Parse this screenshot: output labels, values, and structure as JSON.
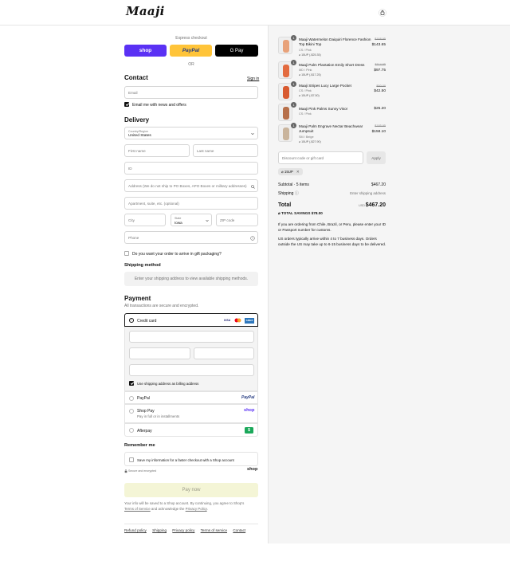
{
  "header": {
    "brand": "Maaji",
    "bag_icon": "shopping-bag-icon"
  },
  "express": {
    "title": "Express checkout",
    "shop_label": "shop",
    "paypal_label": "PayPal",
    "gpay_label": "G Pay",
    "or_label": "OR",
    "colors": {
      "shop": "#5a31f4",
      "paypal": "#ffc439",
      "gpay": "#000000"
    }
  },
  "contact": {
    "title": "Contact",
    "sign_in": "Sign in",
    "email_placeholder": "Email",
    "news_label": "Email me with news and offers"
  },
  "delivery": {
    "title": "Delivery",
    "country_label": "Country/Region",
    "country_value": "United States",
    "first_name": "First name",
    "last_name": "Last name",
    "id_field": "ID",
    "address": "Address (We do not ship to PO Boxes, APO Boxes or military addresses)",
    "apartment": "Apartment, suite, etc. (optional)",
    "city": "City",
    "state_label": "State",
    "state_value": "Iowa",
    "zip": "ZIP code",
    "phone": "Phone",
    "gift_label": "Do you want your order to arrive in gift packaging?"
  },
  "shipping": {
    "title": "Shipping method",
    "notice": "Enter your shipping address to view available shipping methods."
  },
  "payment": {
    "title": "Payment",
    "subtitle": "All transactions are secure and encrypted.",
    "credit_card": "Credit card",
    "card_brands": [
      "VISA",
      "MC",
      "AMEX"
    ],
    "billing_label": "Use shipping address as billing address",
    "paypal": "PayPal",
    "paypal_logo": "PayPal",
    "shop_pay": "Shop Pay",
    "shop_pay_sub": "Pay in full or in installments",
    "shop_logo": "shop",
    "afterpay": "Afterpay",
    "afterpay_logo": "$"
  },
  "remember": {
    "title": "Remember me",
    "save_label": "Save my information for a faster checkout with a Shop account",
    "secure": "Secure and encrypted",
    "shop_logo": "shop"
  },
  "pay_now": "Pay now",
  "legal": {
    "line1": "Your info will be saved to a Shop account. By continuing, you agree to Shop’s",
    "terms": "Terms of Service",
    "mid": " and acknowledge the ",
    "privacy": "Privacy Policy",
    "end": "."
  },
  "footer": [
    "Refund policy",
    "Shipping",
    "Privacy policy",
    "Terms of service",
    "Contact"
  ],
  "cart": {
    "items": [
      {
        "qty": "1",
        "name": "Maaji Watermelon Daiquiri Florence Fashion Top Bikini Top",
        "variant": "CS / Pink",
        "discount": "15UP (-$25.35)",
        "old_price": "$168.95",
        "price": "$143.65",
        "thumb_color": "#e8a27a"
      },
      {
        "qty": "1",
        "name": "Maaji Palm Plantation Emily Short Dress",
        "variant": "MD / Pink",
        "discount": "15UP (-$17.25)",
        "old_price": "$114.95",
        "price": "$97.75",
        "thumb_color": "#e36b3f"
      },
      {
        "qty": "1",
        "name": "Maaji Stripes Lucy Large Pocket",
        "variant": "CS / Pink",
        "discount": "15UP (-$7.50)",
        "old_price": "$50.00",
        "price": "$42.50",
        "thumb_color": "#d85a30"
      },
      {
        "qty": "1",
        "name": "Maaji Pink Palms Sunny Visor",
        "variant": "CS / Pink",
        "discount": "",
        "old_price": "",
        "price": "$25.20",
        "thumb_color": "#b7704a"
      },
      {
        "qty": "1",
        "name": "Maaji Palm Engrave Nectar Beachwear Jumpsuit",
        "variant": "SM / Beige",
        "discount": "15UP (-$27.90)",
        "old_price": "$185.95",
        "price": "$158.10",
        "thumb_color": "#c9b49c"
      }
    ],
    "discount_placeholder": "Discount code or gift card",
    "apply": "Apply",
    "code_tag": "15UP",
    "subtotal_label": "Subtotal · 5 items",
    "subtotal_value": "$467.20",
    "shipping_label": "Shipping",
    "shipping_value": "Enter shipping address",
    "total_label": "Total",
    "currency": "USD",
    "total_value": "$467.20",
    "savings_label": "TOTAL SAVINGS",
    "savings_value": "$78.00",
    "note1": "If you are ordering from Chile, Brazil, or Peru, please enter your ID or Passport number for customs.",
    "note2": "US orders typically arrive within 4 to 7 business days. Orders outside the US may take up to 6-15 business days to be delivered."
  }
}
